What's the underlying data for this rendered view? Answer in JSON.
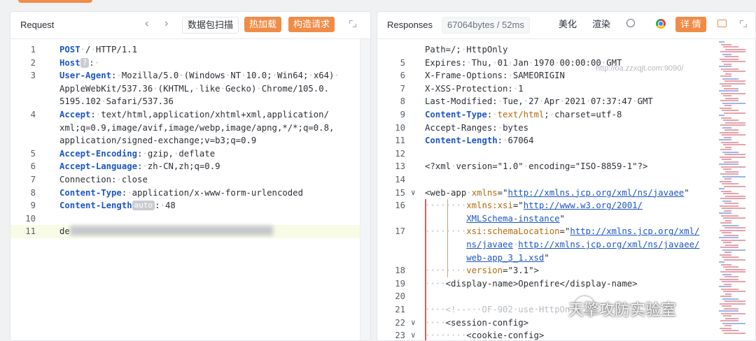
{
  "request": {
    "title": "Request",
    "buttons": {
      "scan": "数据包扫描",
      "hot_load": "热加载",
      "build": "构造请求"
    },
    "lines": [
      {
        "n": "1",
        "parts": [
          [
            "k",
            "POST"
          ],
          [
            "ws",
            "·"
          ],
          [
            "s",
            "/"
          ],
          [
            "ws",
            "·"
          ],
          [
            "s",
            "HTTP/1.1"
          ]
        ]
      },
      {
        "n": "2",
        "parts": [
          [
            "k",
            "Host"
          ],
          [
            "chip",
            "?"
          ],
          [
            "s",
            ":"
          ],
          [
            "ws",
            "·"
          ]
        ]
      },
      {
        "n": "3",
        "parts": [
          [
            "k",
            "User-Agent"
          ],
          [
            "s",
            ":"
          ],
          [
            "ws",
            "·"
          ],
          [
            "s",
            "Mozilla/5.0"
          ],
          [
            "ws",
            "·"
          ],
          [
            "s",
            "(Windows"
          ],
          [
            "ws",
            "·"
          ],
          [
            "s",
            "NT"
          ],
          [
            "ws",
            "·"
          ],
          [
            "s",
            "10.0;"
          ],
          [
            "ws",
            "·"
          ],
          [
            "s",
            "Win64;"
          ],
          [
            "ws",
            "·"
          ],
          [
            "s",
            "x64)"
          ],
          [
            "ws",
            "·"
          ]
        ]
      },
      {
        "n": "",
        "parts": [
          [
            "s",
            "AppleWebKit/537.36"
          ],
          [
            "ws",
            "·"
          ],
          [
            "s",
            "(KHTML,"
          ],
          [
            "ws",
            "·"
          ],
          [
            "s",
            "like"
          ],
          [
            "ws",
            "·"
          ],
          [
            "s",
            "Gecko)"
          ],
          [
            "ws",
            "·"
          ],
          [
            "s",
            "Chrome/105.0."
          ]
        ]
      },
      {
        "n": "",
        "parts": [
          [
            "s",
            "5195.102"
          ],
          [
            "ws",
            "·"
          ],
          [
            "s",
            "Safari/537.36"
          ]
        ]
      },
      {
        "n": "4",
        "parts": [
          [
            "k",
            "Accept"
          ],
          [
            "s",
            ":"
          ],
          [
            "ws",
            "·"
          ],
          [
            "s",
            "text/html,application/xhtml+xml,application/"
          ]
        ]
      },
      {
        "n": "",
        "parts": [
          [
            "s",
            "xml;q=0.9,image/avif,image/webp,image/apng,*/*;q=0.8,"
          ]
        ]
      },
      {
        "n": "",
        "parts": [
          [
            "s",
            "application/signed-exchange;v=b3;q=0.9"
          ]
        ]
      },
      {
        "n": "5",
        "parts": [
          [
            "k",
            "Accept-Encoding"
          ],
          [
            "s",
            ":"
          ],
          [
            "ws",
            "·"
          ],
          [
            "s",
            "gzip,"
          ],
          [
            "ws",
            "·"
          ],
          [
            "s",
            "deflate"
          ]
        ]
      },
      {
        "n": "6",
        "parts": [
          [
            "k",
            "Accept-Language"
          ],
          [
            "s",
            ":"
          ],
          [
            "ws",
            "·"
          ],
          [
            "s",
            "zh-CN,zh;q=0.9"
          ]
        ]
      },
      {
        "n": "7",
        "parts": [
          [
            "s",
            "Connection:"
          ],
          [
            "ws",
            "·"
          ],
          [
            "s",
            "close"
          ]
        ]
      },
      {
        "n": "8",
        "parts": [
          [
            "k",
            "Content-Type"
          ],
          [
            "s",
            ":"
          ],
          [
            "ws",
            "·"
          ],
          [
            "s",
            "application/x-www-form-urlencoded"
          ]
        ]
      },
      {
        "n": "9",
        "parts": [
          [
            "k",
            "Content-Length"
          ],
          [
            "chip",
            "auto"
          ],
          [
            "s",
            ":"
          ],
          [
            "ws",
            "·"
          ],
          [
            "s",
            "48"
          ]
        ]
      },
      {
        "n": "10",
        "parts": []
      },
      {
        "n": "11",
        "parts": [
          [
            "s",
            "de"
          ],
          [
            "blur",
            ""
          ]
        ]
      }
    ]
  },
  "response": {
    "title": "Responses",
    "size": "67064bytes / 52ms",
    "buttons": {
      "beautify": "美化",
      "render": "渲染",
      "detail": "详 情"
    },
    "faded": "http://oa.zzxqjt.com:9090/",
    "lines": [
      {
        "n": "",
        "parts": [
          [
            "s",
            "Path=/;"
          ],
          [
            "ws",
            "·"
          ],
          [
            "s",
            "HttpOnly"
          ]
        ]
      },
      {
        "n": "5",
        "parts": [
          [
            "s",
            "Expires:"
          ],
          [
            "ws",
            "·"
          ],
          [
            "s",
            "Thu,"
          ],
          [
            "ws",
            "·"
          ],
          [
            "s",
            "01"
          ],
          [
            "ws",
            "·"
          ],
          [
            "s",
            "Jan"
          ],
          [
            "ws",
            "·"
          ],
          [
            "s",
            "1970"
          ],
          [
            "ws",
            "·"
          ],
          [
            "s",
            "00:00:00"
          ],
          [
            "ws",
            "·"
          ],
          [
            "s",
            "GMT"
          ]
        ]
      },
      {
        "n": "6",
        "parts": [
          [
            "s",
            "X-Frame-Options:"
          ],
          [
            "ws",
            "·"
          ],
          [
            "s",
            "SAMEORIGIN"
          ]
        ]
      },
      {
        "n": "7",
        "parts": [
          [
            "s",
            "X-XSS-Protection:"
          ],
          [
            "ws",
            "·"
          ],
          [
            "s",
            "1"
          ]
        ]
      },
      {
        "n": "8",
        "parts": [
          [
            "s",
            "Last-Modified:"
          ],
          [
            "ws",
            "·"
          ],
          [
            "s",
            "Tue,"
          ],
          [
            "ws",
            "·"
          ],
          [
            "s",
            "27"
          ],
          [
            "ws",
            "·"
          ],
          [
            "s",
            "Apr"
          ],
          [
            "ws",
            "·"
          ],
          [
            "s",
            "2021"
          ],
          [
            "ws",
            "·"
          ],
          [
            "s",
            "07:37:47"
          ],
          [
            "ws",
            "·"
          ],
          [
            "s",
            "GMT"
          ]
        ]
      },
      {
        "n": "9",
        "parts": [
          [
            "k",
            "Content-Type"
          ],
          [
            "s",
            ":"
          ],
          [
            "ws",
            "·"
          ],
          [
            "at",
            "text/html"
          ],
          [
            "s",
            ";"
          ],
          [
            "ws",
            "·"
          ],
          [
            "s",
            "charset=utf-8"
          ]
        ]
      },
      {
        "n": "10",
        "parts": [
          [
            "s",
            "Accept-Ranges:"
          ],
          [
            "ws",
            "·"
          ],
          [
            "s",
            "bytes"
          ]
        ]
      },
      {
        "n": "11",
        "parts": [
          [
            "k",
            "Content-Length"
          ],
          [
            "s",
            ":"
          ],
          [
            "ws",
            "·"
          ],
          [
            "s",
            "67064"
          ]
        ]
      },
      {
        "n": "12",
        "parts": []
      },
      {
        "n": "13",
        "parts": [
          [
            "s",
            "<?xml"
          ],
          [
            "ws",
            "·"
          ],
          [
            "s",
            "version=\"1.0\""
          ],
          [
            "ws",
            "·"
          ],
          [
            "s",
            "encoding=\"ISO-8859-1\"?>"
          ]
        ]
      },
      {
        "n": "14",
        "parts": []
      },
      {
        "n": "15",
        "parts": [
          [
            "s",
            "<web-app"
          ],
          [
            "ws",
            "·"
          ],
          [
            "at",
            "xmlns"
          ],
          [
            "s",
            "=\""
          ],
          [
            "link",
            "http://xmlns.jcp.org/xml/ns/javaee"
          ],
          [
            "s",
            "\""
          ]
        ]
      },
      {
        "n": "16",
        "parts": [
          [
            "ws",
            "········"
          ],
          [
            "at",
            "xmlns:xsi"
          ],
          [
            "s",
            "=\""
          ],
          [
            "link",
            "http://www.w3.org/2001/"
          ]
        ]
      },
      {
        "n": "",
        "parts": [
          [
            "ws",
            "        "
          ],
          [
            "link",
            "XMLSchema-instance"
          ],
          [
            "s",
            "\""
          ]
        ]
      },
      {
        "n": "17",
        "parts": [
          [
            "ws",
            "········"
          ],
          [
            "at",
            "xsi:schemaLocation"
          ],
          [
            "s",
            "=\""
          ],
          [
            "link",
            "http://xmlns.jcp.org/xml/"
          ]
        ]
      },
      {
        "n": "",
        "parts": [
          [
            "ws",
            "        "
          ],
          [
            "link",
            "ns/javaee"
          ],
          [
            "ws",
            "·"
          ],
          [
            "link",
            "http://xmlns.jcp.org/xml/ns/javaee/"
          ]
        ]
      },
      {
        "n": "",
        "parts": [
          [
            "ws",
            "        "
          ],
          [
            "link",
            "web-app_3_1.xsd"
          ],
          [
            "s",
            "\""
          ]
        ]
      },
      {
        "n": "18",
        "parts": [
          [
            "ws",
            "········"
          ],
          [
            "at",
            "version"
          ],
          [
            "s",
            "=\"3.1\">"
          ]
        ]
      },
      {
        "n": "19",
        "parts": [
          [
            "ws",
            "····"
          ],
          [
            "s",
            "<display-name>Openfire</display-name>"
          ]
        ]
      },
      {
        "n": "20",
        "parts": []
      },
      {
        "n": "21",
        "parts": [
          [
            "ws",
            "····<!--···OF-902·use·HttpOn"
          ]
        ]
      },
      {
        "n": "22",
        "parts": [
          [
            "ws",
            "····"
          ],
          [
            "s",
            "<session-config>"
          ]
        ]
      },
      {
        "n": "23",
        "parts": [
          [
            "ws",
            "········"
          ],
          [
            "s",
            "<cookie-config>"
          ]
        ]
      }
    ]
  },
  "watermark": "天擎攻防实验室",
  "colors": {
    "accent": "#f08c47",
    "keyword": "#1d56c9",
    "attr": "#b56a10"
  }
}
